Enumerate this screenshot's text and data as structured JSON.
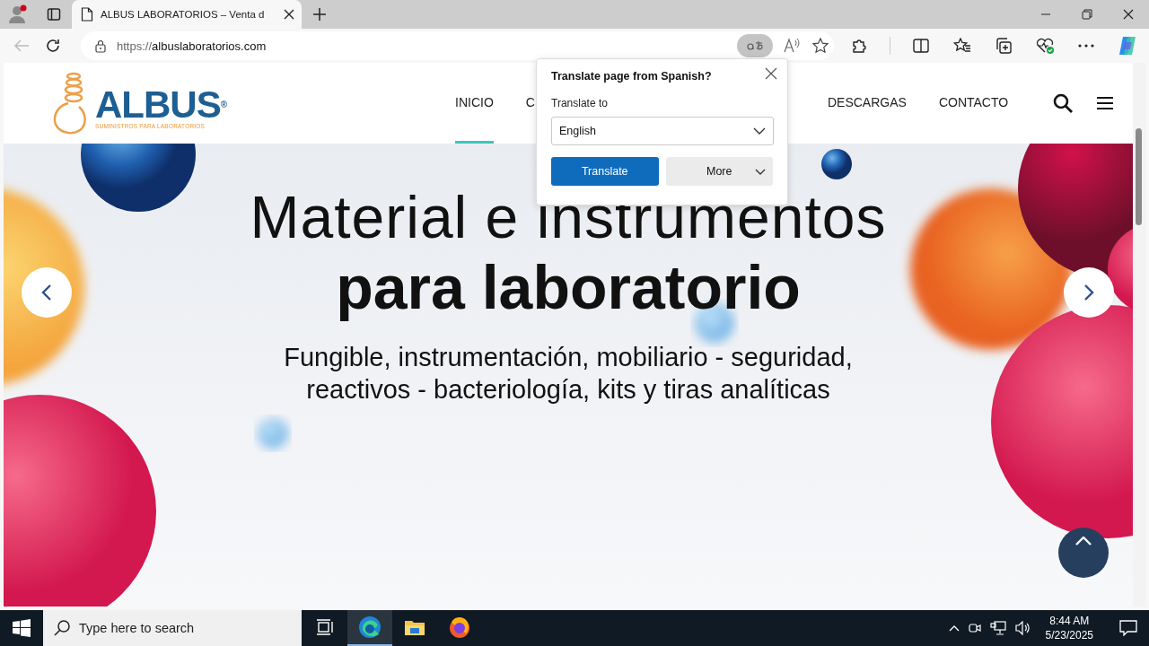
{
  "browser": {
    "tabs": [
      {
        "title": "ALBUS LABORATORIOS – Venta d",
        "selected": true
      }
    ],
    "address": {
      "scheme": "https://",
      "host": "albuslaboratorios.com"
    }
  },
  "site": {
    "logo": {
      "name": "ALBUS$^{®}$",
      "tagline": "SUMINISTROS PARA LABORATORIOS"
    },
    "nav": [
      {
        "label": "INICIO",
        "selected": true
      },
      {
        "label": "C",
        "selected": false
      },
      {
        "label": "DESCARGAS",
        "selected": false
      },
      {
        "label": "CONTACTO",
        "selected": false
      }
    ]
  },
  "hero": {
    "title_lines": [
      "Material e instrumentos",
      "para laboratorio"
    ],
    "subtitle_lines": [
      "Fungible, instrumentación, mobiliario - seguridad,",
      "reactivos - bacteriología, kits y tiras analíticas"
    ]
  },
  "translate_popup": {
    "title": "Translate page from Spanish?",
    "label": "Translate to",
    "language": "English",
    "buttons": [
      {
        "label": "Translate",
        "kind": "primary"
      },
      {
        "label": "More",
        "kind": "menu"
      }
    ]
  },
  "taskbar": {
    "search_placeholder": "Type here to search",
    "apps": [
      {
        "kind": "taskview",
        "selected": false
      },
      {
        "kind": "edge",
        "selected": true
      },
      {
        "kind": "explorer",
        "selected": false
      },
      {
        "kind": "firefox",
        "selected": false
      }
    ],
    "time": "8:44 AM",
    "date": "5/23/2025"
  }
}
